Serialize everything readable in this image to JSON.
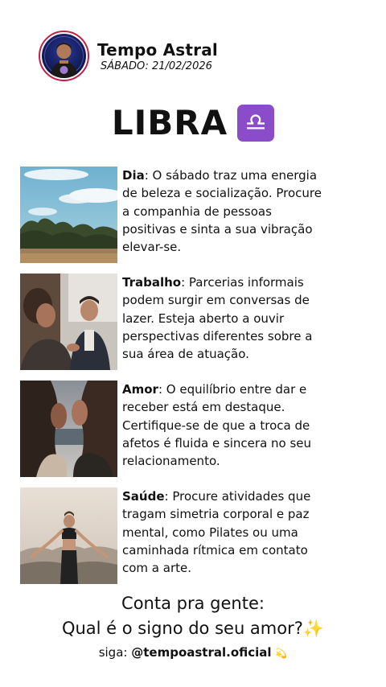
{
  "header": {
    "brand_name": "Tempo Astral",
    "date": "SÁBADO: 21/02/2026",
    "avatar": "host-avatar"
  },
  "sign": {
    "name": "LIBRA",
    "glyph": "♎",
    "badge_color": "#8a4cc9"
  },
  "sections": [
    {
      "title": "Dia",
      "text": ": O sábado traz uma energia de beleza e socialização. Procure a companhia de pessoas positivas e sinta a sua vibração elevar-se.",
      "image": "sky-trees-landscape"
    },
    {
      "title": "Trabalho",
      "text": ": Parcerias informais podem surgir em conversas de lazer. Esteja aberto a ouvir perspectivas diferentes sobre a sua área de atuação.",
      "image": "colleagues-conversation"
    },
    {
      "title": "Amor",
      "text": ": O equilíbrio entre dar e receber está em destaque. Certifique-se de que a troca de afetos é fluida e sincera no seu relacionamento.",
      "image": "couple-by-the-sea"
    },
    {
      "title": "Saúde",
      "text": ": Procure atividades que tragam simetria corporal e paz mental, como Pilates ou uma caminhada rítmica em contato com a arte.",
      "image": "woman-exercising-outdoors"
    }
  ],
  "cta": {
    "line1": "Conta pra gente:",
    "line2": "Qual é o signo do seu amor?",
    "line2_emoji": "✨",
    "follow_prefix": "siga: ",
    "handle": "@tempoastral.oficial",
    "handle_emoji": "💫"
  }
}
